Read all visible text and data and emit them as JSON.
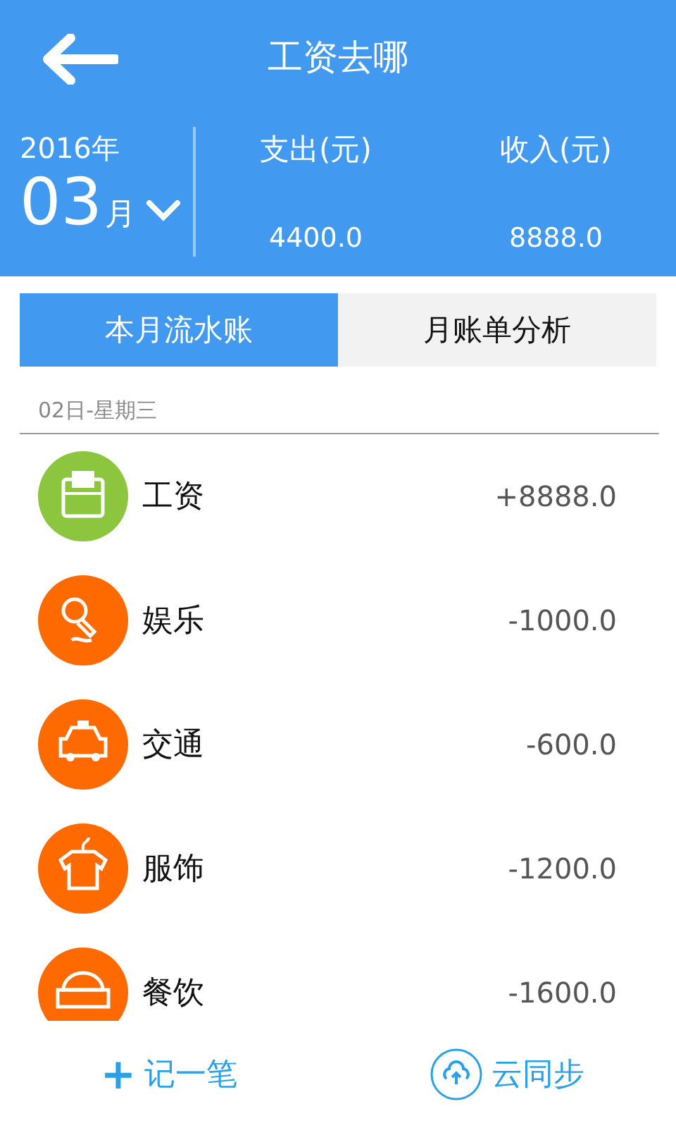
{
  "header": {
    "title": "工资去哪"
  },
  "summary": {
    "year": "2016年",
    "month": "03",
    "month_unit": "月",
    "columns": [
      {
        "label": "支出(元)",
        "value": "4400.0"
      },
      {
        "label": "收入(元)",
        "value": "8888.0"
      }
    ]
  },
  "tabs": [
    {
      "label": "本月流水账",
      "selected": true
    },
    {
      "label": "月账单分析",
      "selected": false
    }
  ],
  "day": {
    "date": "02日-星期三",
    "entries": [
      {
        "name": "工资",
        "amount": "+8888.0",
        "color": "#8cc63f"
      },
      {
        "name": "娱乐",
        "amount": "-1000.0",
        "color": "#ff6a00"
      },
      {
        "name": "交通",
        "amount": "-600.0",
        "color": "#ff6a00"
      },
      {
        "name": "服饰",
        "amount": "-1200.0",
        "color": "#ff6a00"
      },
      {
        "name": "餐饮",
        "amount": "-1600.0",
        "color": "#ff6a00"
      }
    ]
  },
  "bottom_bar": [
    {
      "label": "记一笔",
      "icon": "+"
    },
    {
      "label": "云同步"
    }
  ]
}
